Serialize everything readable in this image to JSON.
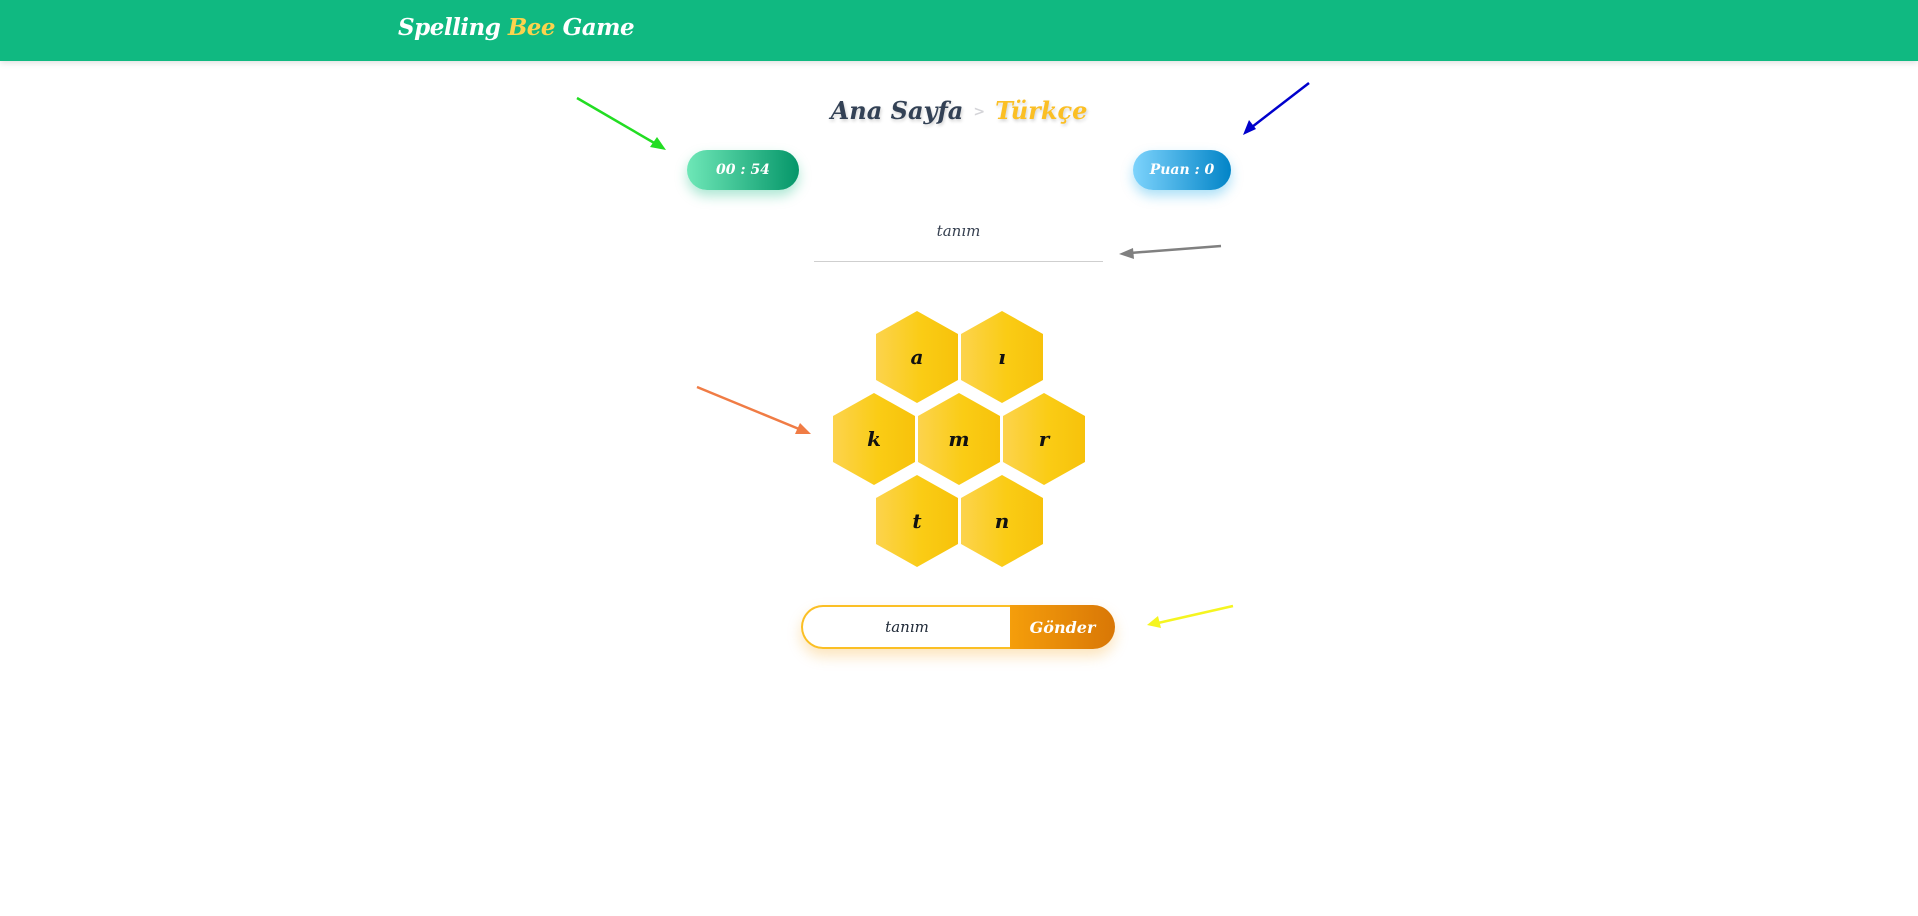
{
  "header": {
    "brand_part1": "Spelling ",
    "brand_accent": "Bee",
    "brand_part3": " Game",
    "background_color": "#10b981",
    "accent_color": "#fcd34d"
  },
  "breadcrumb": {
    "home": "Ana Sayfa",
    "separator": ">",
    "current": "Türkçe"
  },
  "timer": {
    "label": "00 : 54"
  },
  "score": {
    "label": "Puan : 0"
  },
  "current_word": "tanım",
  "letters": {
    "top_left": "a",
    "top_right": "ı",
    "mid_left": "k",
    "center": "m",
    "mid_right": "r",
    "bottom_left": "t",
    "bottom_right": "n"
  },
  "form": {
    "input_value": "tanım",
    "submit_label": "Gönder"
  },
  "annotation_arrow_colors": {
    "timer_arrow": "#22dd22",
    "score_arrow": "#0000cc",
    "word_arrow": "#808080",
    "hive_arrow": "#f07c45",
    "form_arrow": "#f5f520"
  }
}
